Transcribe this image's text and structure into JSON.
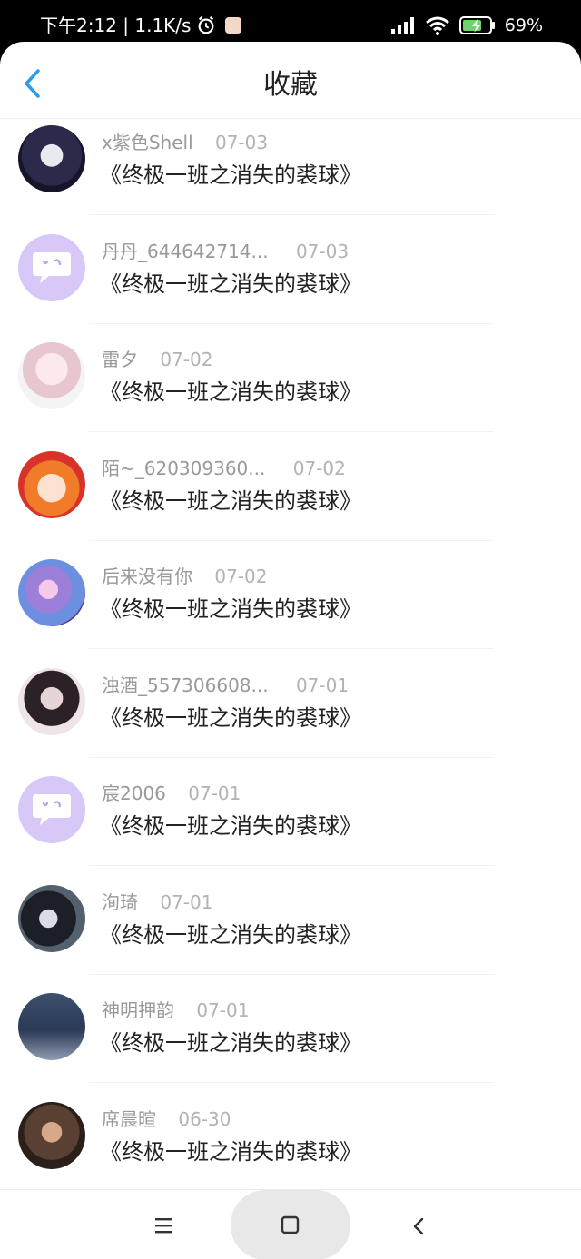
{
  "status_bar": {
    "time_speed": "下午2:12 | 1.1K/s",
    "battery": "69%"
  },
  "header": {
    "title": "收藏",
    "back_icon": "chevron-left-icon",
    "accent": "#2a9cf0"
  },
  "items": [
    {
      "user": "x紫色Shell",
      "date": "07-03",
      "title": "《终极一班之消失的裘球》",
      "avatar": "photo"
    },
    {
      "user": "丹丹_644642714...",
      "date": "07-03",
      "title": "《终极一班之消失的裘球》",
      "avatar": "default"
    },
    {
      "user": "雷夕",
      "date": "07-02",
      "title": "《终极一班之消失的裘球》",
      "avatar": "photo"
    },
    {
      "user": "陌~_620309360...",
      "date": "07-02",
      "title": "《终极一班之消失的裘球》",
      "avatar": "photo"
    },
    {
      "user": "后来没有你",
      "date": "07-02",
      "title": "《终极一班之消失的裘球》",
      "avatar": "photo"
    },
    {
      "user": "浊酒_557306608...",
      "date": "07-01",
      "title": "《终极一班之消失的裘球》",
      "avatar": "photo"
    },
    {
      "user": "宸2006",
      "date": "07-01",
      "title": "《终极一班之消失的裘球》",
      "avatar": "default"
    },
    {
      "user": "洵琦",
      "date": "07-01",
      "title": "《终极一班之消失的裘球》",
      "avatar": "photo"
    },
    {
      "user": "神明押韵",
      "date": "07-01",
      "title": "《终极一班之消失的裘球》",
      "avatar": "photo"
    },
    {
      "user": "席晨暄",
      "date": "06-30",
      "title": "《终极一班之消失的裘球》",
      "avatar": "photo"
    }
  ],
  "nav": {
    "menu_icon": "menu-icon",
    "home_icon": "home-square-icon",
    "back_icon": "back-chevron-icon"
  }
}
